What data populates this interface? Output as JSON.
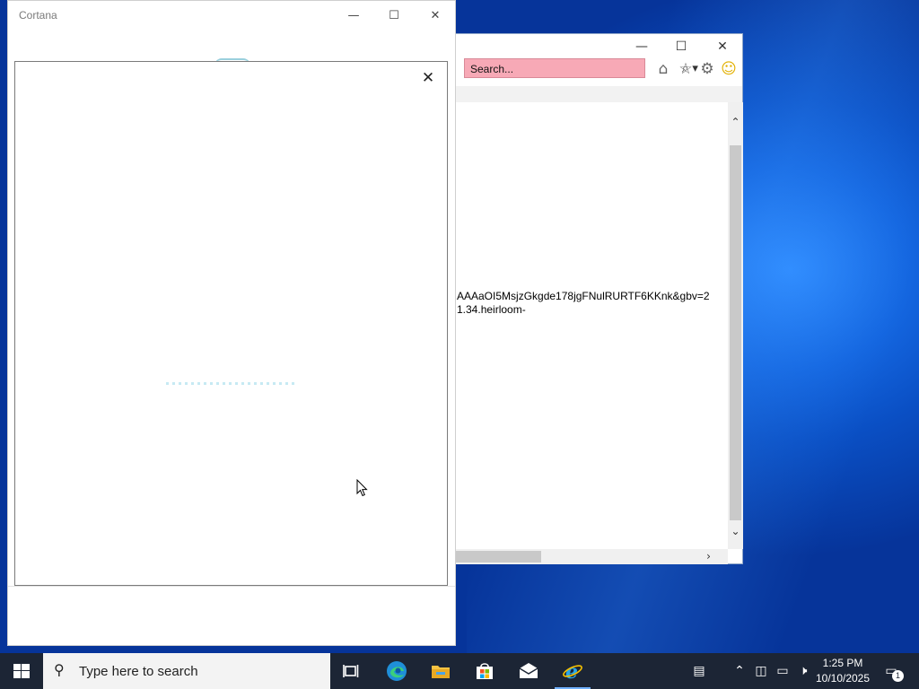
{
  "colors": {
    "desktop_accent": "#1466e0",
    "taskbar": "#1c2535",
    "ie_search_bg": "#f7a9b6",
    "active_indicator": "#6fb0ff"
  },
  "ie_window": {
    "search_placeholder": "Search...",
    "search_icon": "magnifier-icon",
    "minimize": "—",
    "maximize": "☐",
    "close": "✕",
    "toolbar_icons": [
      "home-icon",
      "favorites-star-icon",
      "settings-gear-icon",
      "feedback-smiley-icon"
    ],
    "content_lines": [
      "AAAaOI5MsjzGkgde178jgFNulRURTF6KKnk&gbv=2",
      "1.34.heirloom-"
    ]
  },
  "cortana_window": {
    "title": "Cortana",
    "minimize": "—",
    "maximize": "☐",
    "close": "✕"
  },
  "dialog": {
    "close": "✕",
    "loading": true
  },
  "taskbar": {
    "search_placeholder": "Type here to search",
    "pinned": [
      "task-view",
      "microsoft-edge",
      "file-explorer",
      "microsoft-store",
      "mail",
      "internet-explorer"
    ],
    "active_app": "internet-explorer",
    "clock_time": "1:25 PM",
    "clock_date": "10/10/2025",
    "notification_count": "1"
  }
}
